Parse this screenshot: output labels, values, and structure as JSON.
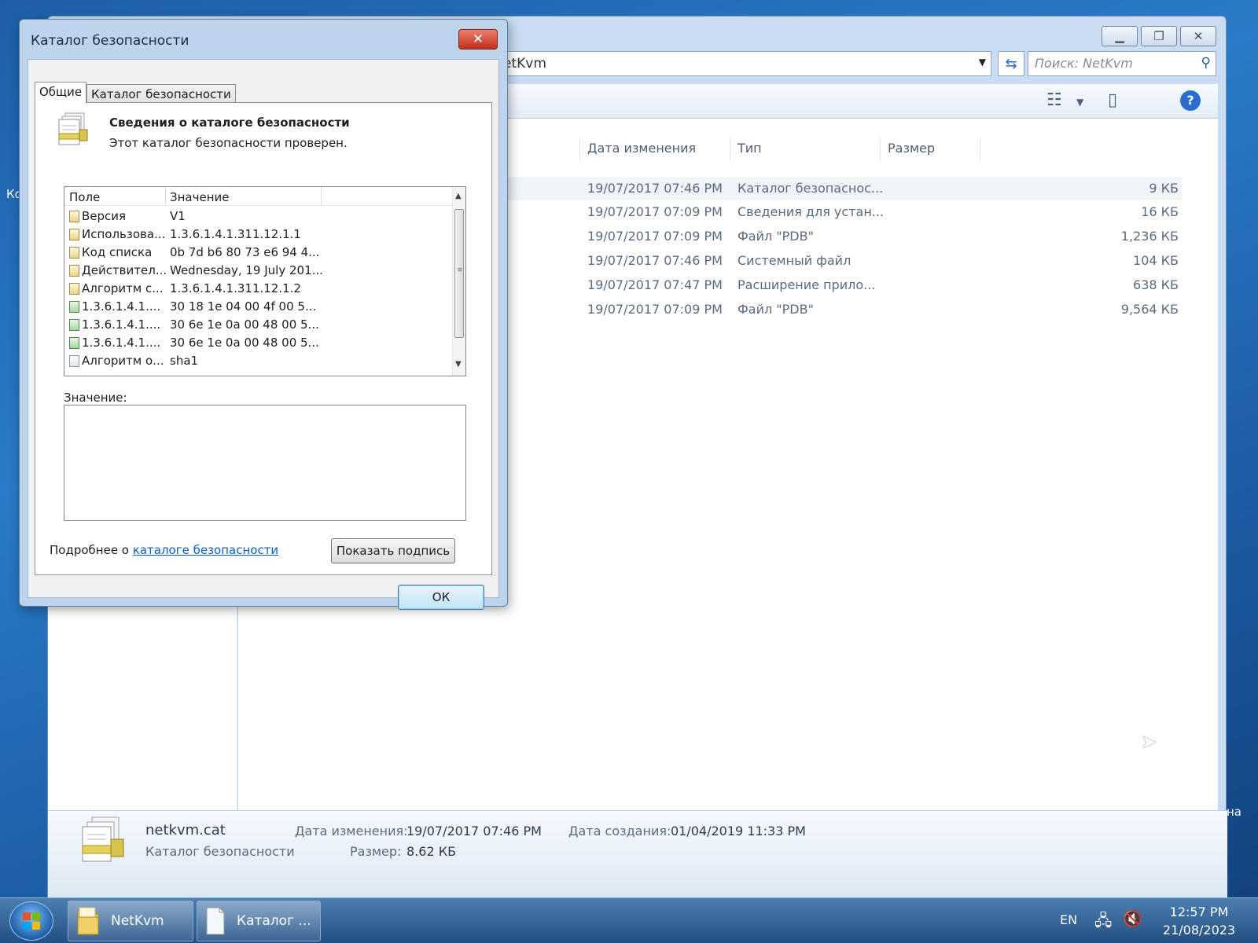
{
  "desktop": {
    "left_fragment": "Ко",
    "right_fragment": "на"
  },
  "explorer": {
    "address": "etKvm",
    "search_placeholder": "Поиск: NetKvm",
    "columns": {
      "date": "Дата изменения",
      "type": "Тип",
      "size": "Размер"
    },
    "rows": [
      {
        "date": "19/07/2017 07:46 PM",
        "type": "Каталог безопаснос...",
        "size": "9 КБ",
        "selected": true
      },
      {
        "date": "19/07/2017 07:09 PM",
        "type": "Сведения для устан...",
        "size": "16 КБ"
      },
      {
        "date": "19/07/2017 07:09 PM",
        "type": "Файл \"PDB\"",
        "size": "1,236 КБ"
      },
      {
        "date": "19/07/2017 07:46 PM",
        "type": "Системный файл",
        "size": "104 КБ"
      },
      {
        "date": "19/07/2017 07:47 PM",
        "type": "Расширение прило...",
        "size": "638 КБ"
      },
      {
        "date": "19/07/2017 07:09 PM",
        "type": "Файл \"PDB\"",
        "size": "9,564 КБ"
      }
    ],
    "details": {
      "filename": "netkvm.cat",
      "filetype": "Каталог безопасности",
      "modified_label": "Дата изменения:",
      "modified_value": "19/07/2017 07:46 PM",
      "created_label": "Дата создания:",
      "created_value": "01/04/2019 11:33 PM",
      "size_label": "Размер:",
      "size_value": "8.62 КБ"
    }
  },
  "dialog": {
    "title": "Каталог безопасности",
    "tabs": [
      "Общие",
      "Каталог безопасности"
    ],
    "heading": "Сведения о каталоге безопасности",
    "subheading": "Этот каталог безопасности проверен.",
    "list_columns": {
      "field": "Поле",
      "value": "Значение"
    },
    "list_rows": [
      {
        "field": "Версия",
        "value": "V1",
        "icon": "doc"
      },
      {
        "field": "Использова...",
        "value": "1.3.6.1.4.1.311.12.1.1",
        "icon": "doc"
      },
      {
        "field": "Код списка",
        "value": "0b 7d b6 80 73 e6 94 4...",
        "icon": "doc"
      },
      {
        "field": "Действител...",
        "value": "Wednesday, 19 July 201...",
        "icon": "doc"
      },
      {
        "field": "Алгоритм с...",
        "value": "1.3.6.1.4.1.311.12.1.2",
        "icon": "doc"
      },
      {
        "field": "1.3.6.1.4.1....",
        "value": "30 18 1e 04 00 4f 00 5...",
        "icon": "green"
      },
      {
        "field": "1.3.6.1.4.1....",
        "value": "30 6e 1e 0a 00 48 00 5...",
        "icon": "green"
      },
      {
        "field": "1.3.6.1.4.1....",
        "value": "30 6e 1e 0a 00 48 00 5...",
        "icon": "green"
      },
      {
        "field": "Алгоритм о...",
        "value": "sha1",
        "icon": "plain"
      }
    ],
    "value_label": "Значение:",
    "more_prefix": "Подробнее о ",
    "more_link": "каталоге безопасности",
    "show_signature": "Показать подпись",
    "ok": "ОК"
  },
  "taskbar": {
    "items": [
      "NetKvm",
      "Каталог ..."
    ],
    "lang": "EN",
    "time": "12:57 PM",
    "date": "21/08/2023"
  }
}
